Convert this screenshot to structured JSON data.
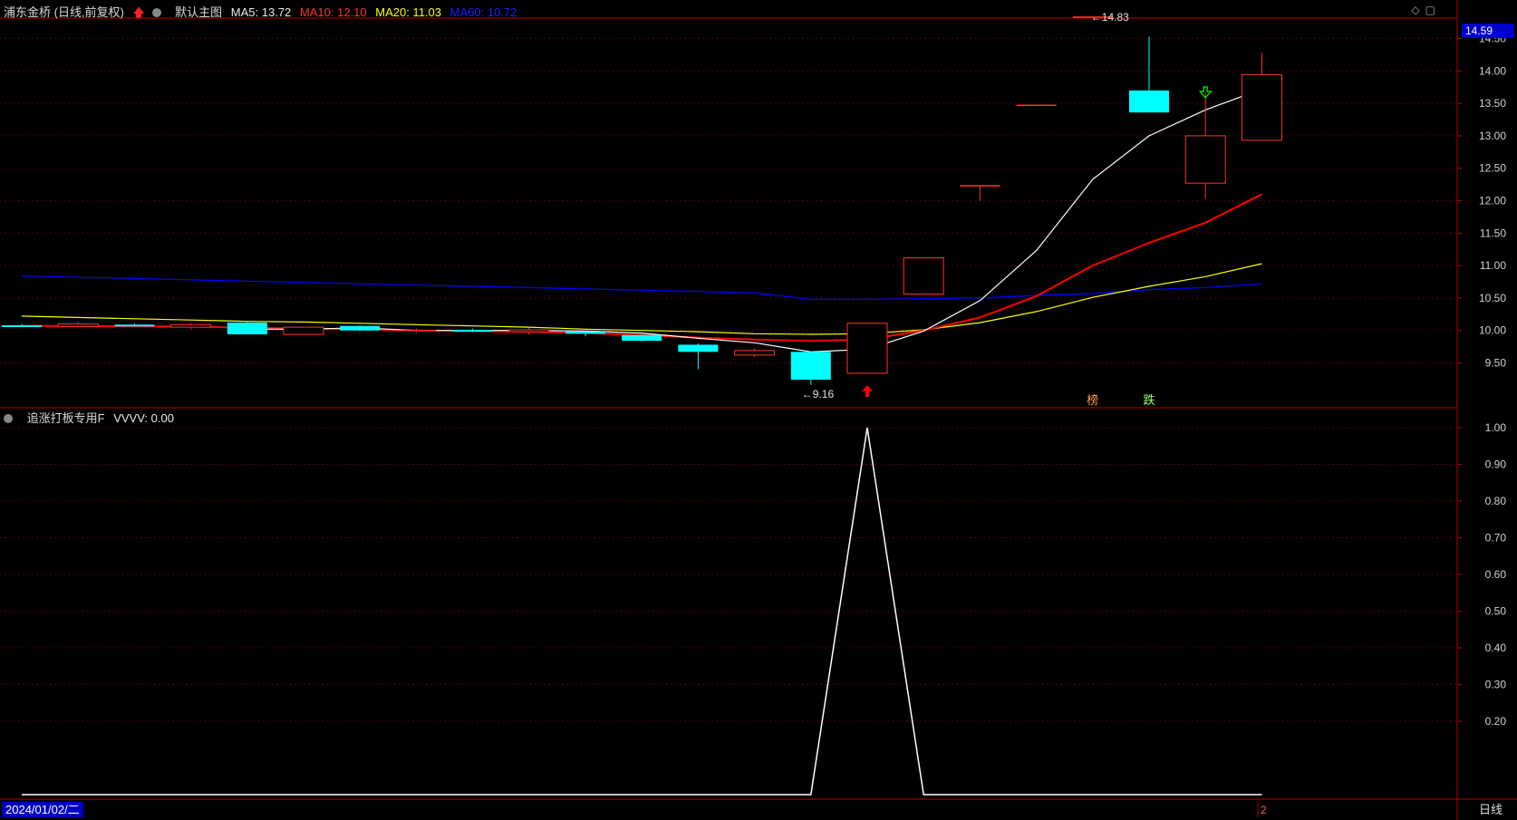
{
  "header": {
    "stock": "浦东金桥 (日线,前复权)",
    "indicator_name": "默认主图",
    "ma5": "MA5: 13.72",
    "ma10": "MA10: 12.10",
    "ma20": "MA20: 11.03",
    "ma60": "MA60: 10.72"
  },
  "sub_header": {
    "indicator": "追涨打板专用F",
    "value": "VVVV: 0.00"
  },
  "footer": {
    "date": "2024/01/02/二",
    "period": "日线",
    "marker": "2"
  },
  "price_tag": "14.59",
  "colors": {
    "up": "#ff3232",
    "down": "#00ffff",
    "ma5": "#ffffff",
    "ma10": "#ff0000",
    "ma20": "#ffff00",
    "ma60": "#0000ff",
    "grid": "#5a0000",
    "axis": "#b40000"
  },
  "icons": [
    "up-arrow-icon",
    "dropdown-icon",
    "diamond-icon",
    "window-icon"
  ],
  "chart_data": [
    {
      "type": "candlestick",
      "title": "浦东金桥 (日线,前复权)",
      "ylim": [
        9.16,
        14.83
      ],
      "y_ticks": [
        9.5,
        10.0,
        10.5,
        11.0,
        11.5,
        12.0,
        12.5,
        13.0,
        13.5,
        14.0,
        14.5
      ],
      "y_tick_labels": [
        "9.50",
        "10.00",
        "10.50",
        "11.00",
        "11.50",
        "12.00",
        "12.50",
        "13.00",
        "13.50",
        "14.00",
        "14.50"
      ],
      "candles": [
        {
          "o": 10.08,
          "h": 10.1,
          "l": 10.06,
          "c": 10.06
        },
        {
          "o": 10.06,
          "h": 10.13,
          "l": 10.05,
          "c": 10.1
        },
        {
          "o": 10.09,
          "h": 10.11,
          "l": 10.06,
          "c": 10.07
        },
        {
          "o": 10.05,
          "h": 10.11,
          "l": 10.02,
          "c": 10.09
        },
        {
          "o": 10.12,
          "h": 10.14,
          "l": 9.94,
          "c": 9.94
        },
        {
          "o": 9.94,
          "h": 10.06,
          "l": 9.93,
          "c": 10.05
        },
        {
          "o": 10.07,
          "h": 10.08,
          "l": 9.99,
          "c": 10.0
        },
        {
          "o": 9.98,
          "h": 10.03,
          "l": 9.96,
          "c": 10.0
        },
        {
          "o": 10.01,
          "h": 10.03,
          "l": 9.97,
          "c": 9.98
        },
        {
          "o": 9.98,
          "h": 10.04,
          "l": 9.93,
          "c": 10.01
        },
        {
          "o": 9.98,
          "h": 10.0,
          "l": 9.91,
          "c": 9.95
        },
        {
          "o": 9.93,
          "h": 9.94,
          "l": 9.83,
          "c": 9.84
        },
        {
          "o": 9.78,
          "h": 9.8,
          "l": 9.4,
          "c": 9.67
        },
        {
          "o": 9.62,
          "h": 9.72,
          "l": 9.59,
          "c": 9.69
        },
        {
          "o": 9.67,
          "h": 9.67,
          "l": 9.16,
          "c": 9.24
        },
        {
          "o": 9.34,
          "h": 10.12,
          "l": 9.34,
          "c": 10.11
        },
        {
          "o": 10.56,
          "h": 11.13,
          "l": 10.56,
          "c": 11.12
        },
        {
          "o": 12.23,
          "h": 12.23,
          "l": 12.0,
          "c": 12.23
        },
        {
          "o": 13.47,
          "h": 13.47,
          "l": 13.47,
          "c": 13.47
        },
        {
          "o": 14.83,
          "h": 14.83,
          "l": 14.83,
          "c": 14.83
        },
        {
          "o": 13.7,
          "h": 14.53,
          "l": 13.36,
          "c": 13.36
        },
        {
          "o": 12.27,
          "h": 13.66,
          "l": 12.02,
          "c": 13.0
        },
        {
          "o": 12.93,
          "h": 14.28,
          "l": 12.93,
          "c": 13.94
        }
      ],
      "ma5": [
        null,
        null,
        null,
        null,
        10.02,
        10.02,
        10.04,
        10.0,
        10.0,
        10.0,
        9.99,
        9.96,
        9.88,
        9.81,
        9.67,
        9.71,
        9.99,
        10.46,
        11.23,
        12.33,
        13.0,
        13.4,
        13.72
      ],
      "ma10": [
        10.07,
        10.07,
        10.06,
        10.06,
        10.04,
        10.03,
        10.02,
        10.0,
        9.99,
        9.98,
        9.96,
        9.93,
        9.89,
        9.86,
        9.84,
        9.86,
        10.0,
        10.2,
        10.53,
        11.0,
        11.35,
        11.66,
        12.1
      ],
      "ma20": [
        10.22,
        10.2,
        10.18,
        10.16,
        10.14,
        10.13,
        10.11,
        10.09,
        10.07,
        10.05,
        10.02,
        10.0,
        9.98,
        9.95,
        9.94,
        9.95,
        10.01,
        10.12,
        10.29,
        10.51,
        10.68,
        10.83,
        11.03
      ],
      "ma60": [
        10.84,
        10.82,
        10.8,
        10.78,
        10.76,
        10.74,
        10.72,
        10.7,
        10.68,
        10.66,
        10.64,
        10.62,
        10.6,
        10.58,
        10.48,
        10.48,
        10.49,
        10.5,
        10.54,
        10.57,
        10.63,
        10.66,
        10.72
      ],
      "annotations": [
        {
          "text": "←9.16",
          "candle": 14,
          "value": 9.16
        },
        {
          "text": "←14.83",
          "candle": 19,
          "value": 14.83
        },
        {
          "text": "榜",
          "candle": 19
        },
        {
          "text": "跌",
          "candle": 20
        }
      ],
      "signals": [
        {
          "candle": 15,
          "icon": "up-arrow-icon",
          "color": "#ff0000"
        },
        {
          "candle": 21,
          "icon": "down-arrow-icon",
          "color": "#00ff00"
        }
      ]
    },
    {
      "type": "line",
      "title": "追涨打板专用F",
      "ylim": [
        0,
        1.0
      ],
      "y_ticks": [
        0.2,
        0.3,
        0.4,
        0.5,
        0.6,
        0.7,
        0.8,
        0.9,
        1.0
      ],
      "y_tick_labels": [
        "0.20",
        "0.30",
        "0.40",
        "0.50",
        "0.60",
        "0.70",
        "0.80",
        "0.90",
        "1.00"
      ],
      "series": [
        {
          "name": "VVVV",
          "values": [
            0,
            0,
            0,
            0,
            0,
            0,
            0,
            0,
            0,
            0,
            0,
            0,
            0,
            0,
            0,
            1,
            0,
            0,
            0,
            0,
            0,
            0,
            0
          ]
        }
      ]
    }
  ]
}
